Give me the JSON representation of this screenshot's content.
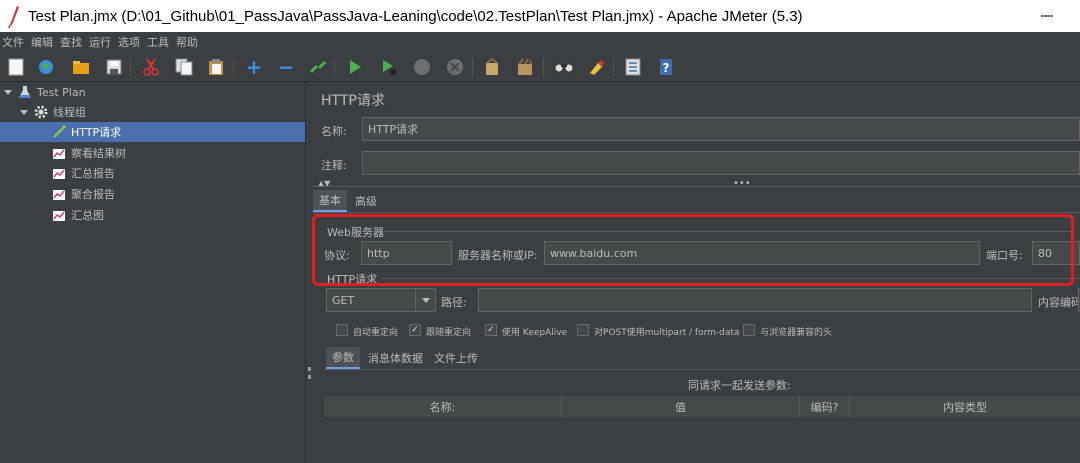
{
  "window": {
    "title": "Test Plan.jmx (D:\\01_Github\\01_PassJava\\PassJava-Leaning\\code\\02.TestPlan\\Test Plan.jmx) - Apache JMeter (5.3)"
  },
  "menu": [
    "文件",
    "编辑",
    "查找",
    "运行",
    "选项",
    "工具",
    "帮助"
  ],
  "toolbar": {
    "icons": [
      "new-icon",
      "templates-icon",
      "open-icon",
      "save-icon",
      "cut-icon",
      "copy-icon",
      "paste-icon",
      "expand-icon",
      "collapse-icon",
      "toggle-icon",
      "start-icon",
      "start-no-pause-icon",
      "stop-icon",
      "shutdown-icon",
      "clear-icon",
      "clear-all-icon",
      "search-icon",
      "reset-search-icon",
      "function-helper-icon",
      "help-icon"
    ]
  },
  "tree": {
    "items": [
      {
        "label": "Test Plan",
        "icon": "flask-icon"
      },
      {
        "label": "线程组",
        "icon": "gear-icon"
      },
      {
        "label": "HTTP请求",
        "icon": "pipette-icon"
      },
      {
        "label": "察看结果树",
        "icon": "chart-icon"
      },
      {
        "label": "汇总报告",
        "icon": "chart-icon"
      },
      {
        "label": "聚合报告",
        "icon": "chart-icon"
      },
      {
        "label": "汇总图",
        "icon": "chart-icon"
      }
    ]
  },
  "panel": {
    "title": "HTTP请求",
    "name_label": "名称:",
    "name_value": "HTTP请求",
    "comment_label": "注释:",
    "comment_value": "",
    "tabs": [
      "基本",
      "高级"
    ],
    "web_server": {
      "group_title": "Web服务器",
      "protocol_label": "协议:",
      "protocol_value": "http",
      "server_label": "服务器名称或IP:",
      "server_value": "www.baidu.com",
      "port_label": "端口号:",
      "port_value": "80"
    },
    "http_request": {
      "group_title": "HTTP请求",
      "method": "GET",
      "path_label": "路径:",
      "path_value": "",
      "encoding_label": "内容编码"
    },
    "checkboxes": [
      {
        "label": "自动重定向",
        "checked": false
      },
      {
        "label": "跟随重定向",
        "checked": true
      },
      {
        "label": "使用 KeepAlive",
        "checked": true
      },
      {
        "label": "对POST使用multipart / form-data",
        "checked": false
      },
      {
        "label": "与浏览器兼容的头",
        "checked": false
      }
    ],
    "sub_tabs": [
      "参数",
      "消息体数据",
      "文件上传"
    ],
    "params_caption": "同请求一起发送参数:",
    "columns": [
      "名称:",
      "值",
      "编码?",
      "内容类型"
    ]
  },
  "colors": {
    "background": "#3c3f41",
    "selection": "#4b6eaf",
    "highlight_box": "#e02020",
    "run_green": "#4caf50",
    "add_blue": "#3d8fe0"
  }
}
